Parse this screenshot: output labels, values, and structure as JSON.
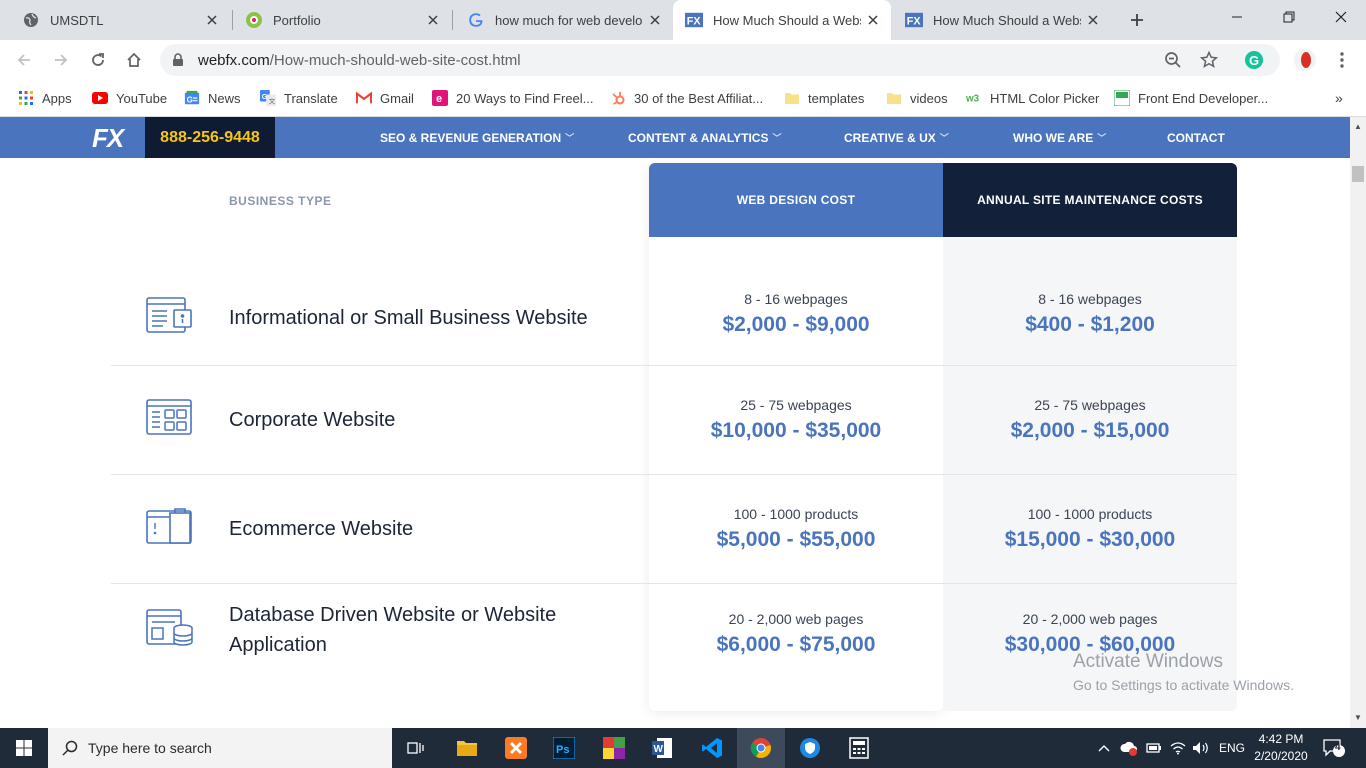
{
  "browser": {
    "tabs": [
      {
        "title": "UMSDTL",
        "favicon": "globe-icon"
      },
      {
        "title": "Portfolio",
        "favicon": "portfolio-icon"
      },
      {
        "title": "how much for web develop",
        "favicon": "google-icon"
      },
      {
        "title": "How Much Should a Webs",
        "favicon": "webfx-icon",
        "active": true
      },
      {
        "title": "How Much Should a Webs",
        "favicon": "webfx-icon"
      }
    ],
    "url_host": "webfx.com",
    "url_path": "/How-much-should-web-site-cost.html",
    "bookmarks": [
      {
        "label": "Apps",
        "icon": "apps-grid-icon"
      },
      {
        "label": "YouTube",
        "icon": "youtube-icon"
      },
      {
        "label": "News",
        "icon": "google-news-icon"
      },
      {
        "label": "Translate",
        "icon": "translate-icon"
      },
      {
        "label": "Gmail",
        "icon": "gmail-icon"
      },
      {
        "label": "20 Ways to Find Freel...",
        "icon": "e-icon"
      },
      {
        "label": "30 of the Best Affiliat...",
        "icon": "hubspot-icon"
      },
      {
        "label": "templates",
        "icon": "folder-icon"
      },
      {
        "label": "videos",
        "icon": "folder-icon"
      },
      {
        "label": "HTML Color Picker",
        "icon": "w3-icon"
      },
      {
        "label": "Front End Developer...",
        "icon": "bookmark-icon"
      }
    ],
    "more_bookmarks": "»"
  },
  "site": {
    "logo": "FX",
    "phone": "888-256-9448",
    "nav": [
      {
        "label": "SEO & REVENUE GENERATION",
        "dropdown": true
      },
      {
        "label": "CONTENT & ANALYTICS",
        "dropdown": true
      },
      {
        "label": "CREATIVE & UX",
        "dropdown": true
      },
      {
        "label": "WHO WE ARE",
        "dropdown": true
      },
      {
        "label": "CONTACT",
        "dropdown": false
      }
    ],
    "accent": "#4a74bd",
    "dark": "#12203a"
  },
  "pricing": {
    "col_type": "BUSINESS TYPE",
    "col_design": "WEB DESIGN COST",
    "col_maint": "ANNUAL SITE MAINTENANCE COSTS",
    "rows": [
      {
        "title": "Informational or Small Business Website",
        "icon": "info-site-icon",
        "design_sub": "8 - 16 webpages",
        "design_price": "$2,000 - $9,000",
        "maint_sub": "8 - 16 webpages",
        "maint_price": "$400 - $1,200"
      },
      {
        "title": "Corporate Website",
        "icon": "corporate-site-icon",
        "design_sub": "25 - 75 webpages",
        "design_price": "$10,000 - $35,000",
        "maint_sub": "25 - 75 webpages",
        "maint_price": "$2,000 - $15,000"
      },
      {
        "title": "Ecommerce Website",
        "icon": "ecommerce-icon",
        "design_sub": "100 - 1000 products",
        "design_price": "$5,000 - $55,000",
        "maint_sub": "100 - 1000 products",
        "maint_price": "$15,000 - $30,000"
      },
      {
        "title": "Database Driven Website or Website Application",
        "icon": "database-site-icon",
        "design_sub": "20 - 2,000 web pages",
        "design_price": "$6,000 - $75,000",
        "maint_sub": "20 - 2,000 web pages",
        "maint_price": "$30,000 - $60,000"
      }
    ]
  },
  "watermark": {
    "line1": "Activate Windows",
    "line2": "Go to Settings to activate Windows."
  },
  "taskbar": {
    "search_placeholder": "Type here to search",
    "language": "ENG",
    "time": "4:42 PM",
    "date": "2/20/2020",
    "notifications": "4"
  }
}
